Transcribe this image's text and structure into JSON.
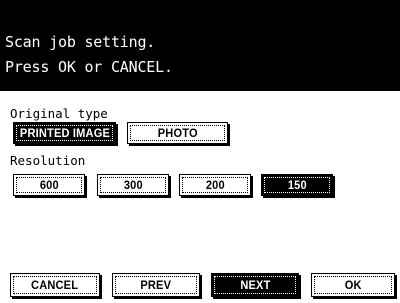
{
  "message": {
    "line1": "Scan job setting.",
    "line2": "Press OK or CANCEL."
  },
  "original_type": {
    "label": "Original type",
    "options": [
      "PRINTED IMAGE",
      "PHOTO"
    ],
    "selected": "PRINTED IMAGE"
  },
  "resolution": {
    "label": "Resolution",
    "options": [
      "600",
      "300",
      "200",
      "150"
    ],
    "selected": "150"
  },
  "footer": {
    "cancel": "CANCEL",
    "prev": "PREV",
    "next": "NEXT",
    "ok": "OK",
    "selected": "NEXT"
  },
  "colors": {
    "background": "#ffffff",
    "header_bg": "#000000",
    "header_text": "#ffffff",
    "selected_bg": "#000000"
  }
}
